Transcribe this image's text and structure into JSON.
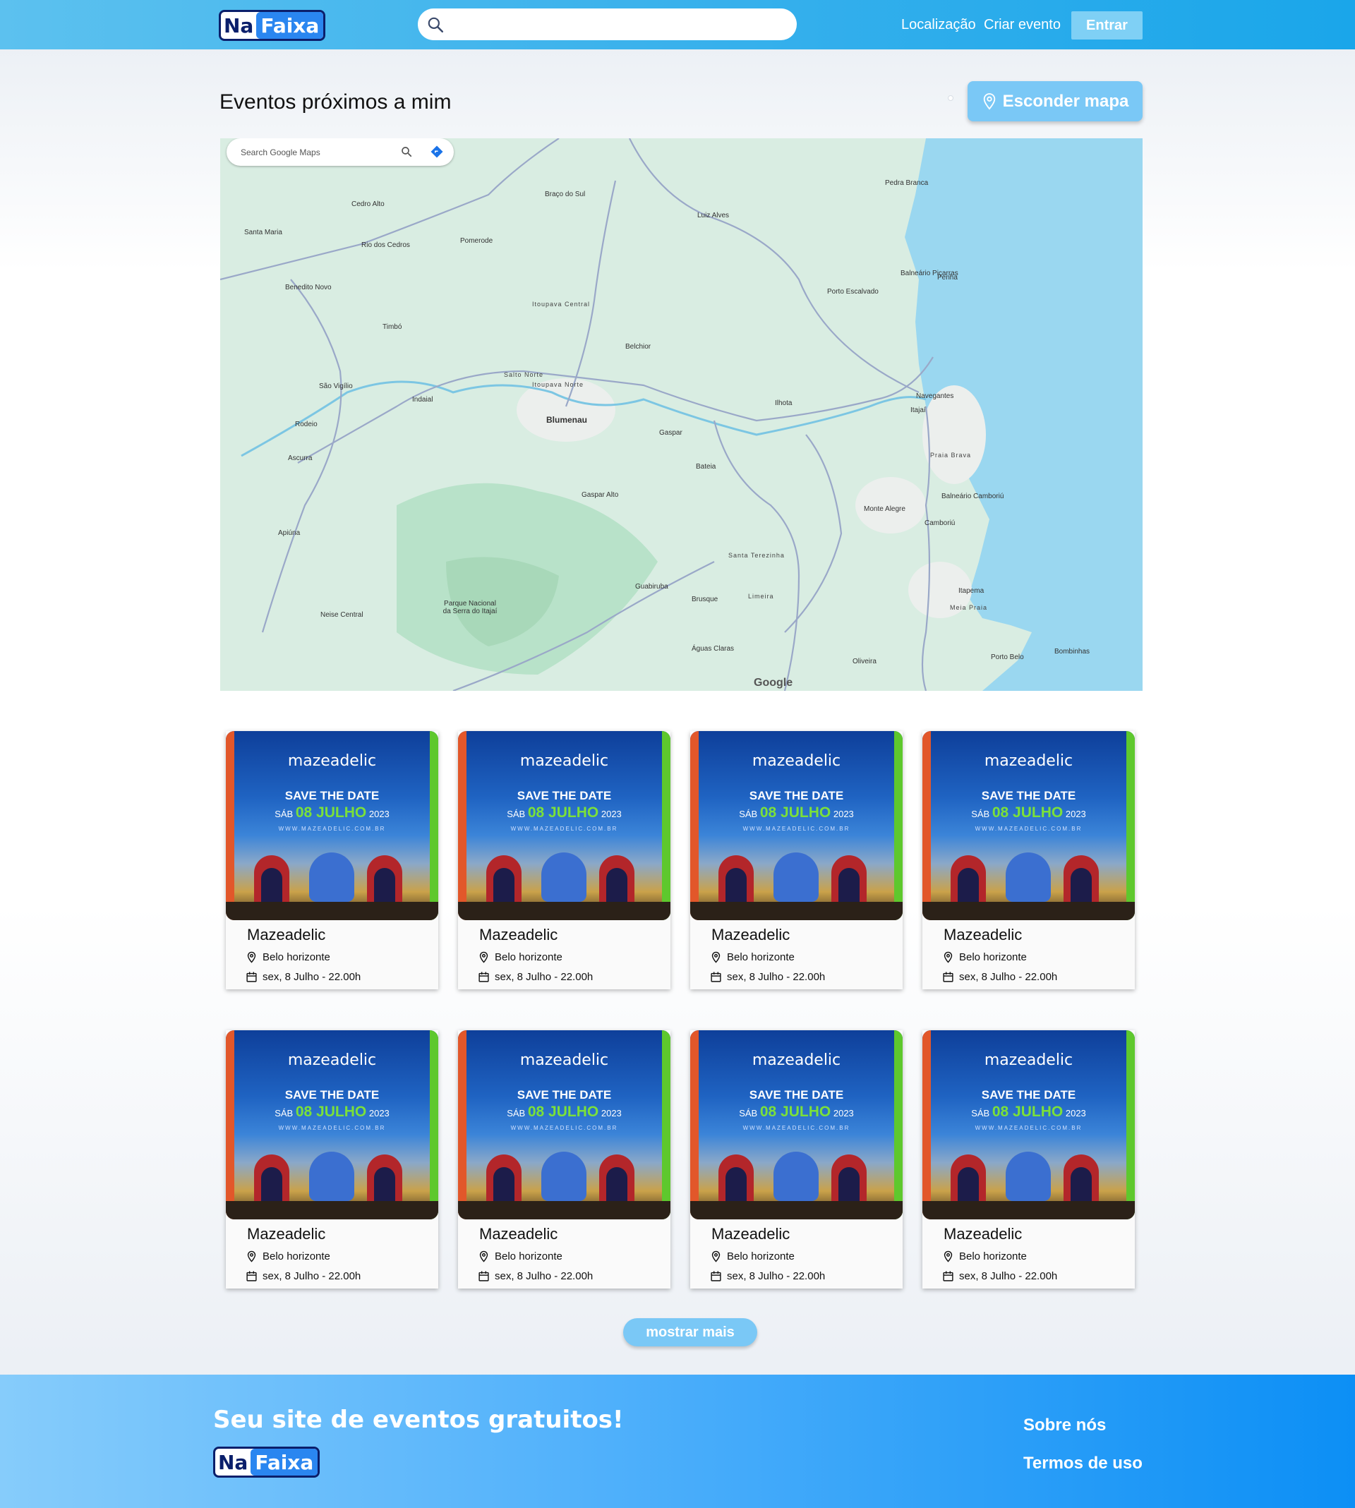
{
  "header": {
    "logo": {
      "na": "Na",
      "faixa": "Faixa"
    },
    "search": {
      "placeholder": ""
    },
    "nav": {
      "location": "Localização",
      "create_event": "Criar evento",
      "login": "Entrar"
    }
  },
  "main": {
    "title": "Eventos próximos a mim",
    "hide_map_label": "Esconder mapa"
  },
  "map": {
    "search_placeholder": "Search Google Maps",
    "attribution": "Google",
    "labels": [
      "Blumenau",
      "Salto Norte",
      "Itoupava Norte",
      "Itoupava Central",
      "Pomerode",
      "Rio dos Cedros",
      "Timbó",
      "Indaial",
      "Gaspar",
      "Ilhota",
      "Navegantes",
      "Itajaí",
      "Balneário Piçarras",
      "Penha",
      "Praia Brava",
      "Balneário Camboriú",
      "Camboriú",
      "Itapema",
      "Brusque",
      "Guabiruba",
      "Gaspar Alto",
      "Belchior",
      "Luiz Alves",
      "Porto Escalvado",
      "Pedra Branca",
      "Benedito Novo",
      "Cedro Alto",
      "Santa Maria",
      "São Vigílio",
      "Rodeio",
      "Ascurra",
      "Apiúna",
      "Neise Central",
      "Parque Nacional da Serra do Itajaí",
      "Monte Alegre",
      "Águas Claras",
      "Oliveira",
      "Bombinhas",
      "Porto Belo",
      "Meia Praia",
      "Braço do Sul",
      "Bateia",
      "Santa Terezinha",
      "Limeira"
    ]
  },
  "events": [
    {
      "name": "Mazeadelic",
      "location": "Belo horizonte",
      "date": "sex, 8 Julho - 22.00h"
    },
    {
      "name": "Mazeadelic",
      "location": "Belo horizonte",
      "date": "sex, 8 Julho - 22.00h"
    },
    {
      "name": "Mazeadelic",
      "location": "Belo horizonte",
      "date": "sex, 8 Julho - 22.00h"
    },
    {
      "name": "Mazeadelic",
      "location": "Belo horizonte",
      "date": "sex, 8 Julho - 22.00h"
    },
    {
      "name": "Mazeadelic",
      "location": "Belo horizonte",
      "date": "sex, 8 Julho - 22.00h"
    },
    {
      "name": "Mazeadelic",
      "location": "Belo horizonte",
      "date": "sex, 8 Julho - 22.00h"
    },
    {
      "name": "Mazeadelic",
      "location": "Belo horizonte",
      "date": "sex, 8 Julho - 22.00h"
    },
    {
      "name": "Mazeadelic",
      "location": "Belo horizonte",
      "date": "sex, 8 Julho - 22.00h"
    }
  ],
  "poster": {
    "brand": "mazeadelic",
    "save": "SAVE THE DATE",
    "day": "SÁB",
    "date": "08 JULHO",
    "year": "2023",
    "url": "WWW.MAZEADELIC.COM.BR"
  },
  "show_more": "mostrar mais",
  "footer": {
    "title": "Seu site de eventos gratuitos!",
    "logo": {
      "na": "Na",
      "faixa": "Faixa"
    },
    "about": "Sobre nós",
    "terms": "Termos de uso"
  },
  "colors": {
    "accent": "#39b1ec",
    "button": "#7ac8f6",
    "brand_navy": "#0b1f6b"
  }
}
